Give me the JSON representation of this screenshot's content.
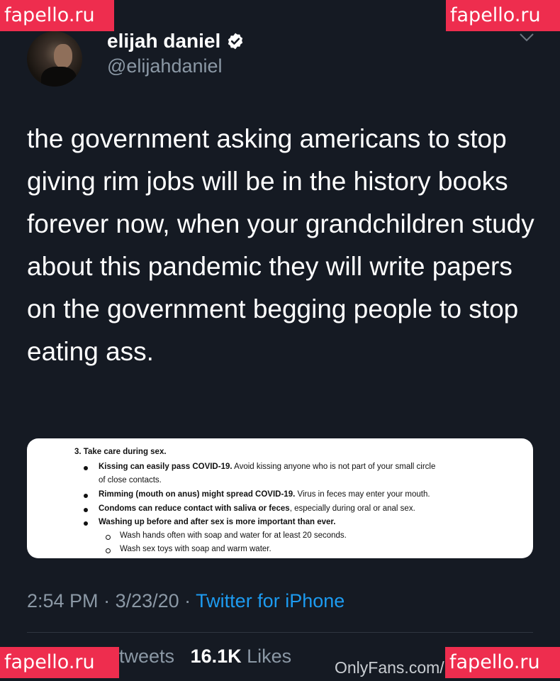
{
  "watermarks": {
    "top_left": "fapello.ru",
    "top_right": "fapello.ru",
    "bottom_left": "fapello.ru",
    "bottom_right": "fapello.ru",
    "onlyfans": "OnlyFans.com/"
  },
  "author": {
    "display_name": "elijah daniel",
    "handle": "@elijahdaniel",
    "verified_icon": "verified-badge-icon",
    "menu_icon": "chevron-down-icon"
  },
  "tweet": {
    "text": "the government asking americans to stop giving rim jobs will be in the history books forever now, when your grandchildren study about this pandemic they will write papers on the government begging people to stop eating ass."
  },
  "media": {
    "heading": "3. Take care during sex.",
    "items": [
      {
        "bold": "Kissing can easily pass COVID-19.",
        "text": " Avoid kissing anyone who is not part of your small circle",
        "continuation": "of close contacts."
      },
      {
        "bold": "Rimming (mouth on anus) might spread COVID-19.",
        "text": " Virus in feces may enter your mouth."
      },
      {
        "bold": "Condoms can reduce contact with saliva or feces",
        "text": ", especially during oral or anal sex."
      },
      {
        "bold": "Washing up before and after sex is more important than ever.",
        "text": ""
      }
    ],
    "subitems": [
      "Wash hands often with soap and water for at least 20 seconds.",
      "Wash sex toys with soap and warm water."
    ]
  },
  "meta": {
    "time": "2:54 PM",
    "separator1": " · ",
    "date": "3/23/20",
    "separator2": " · ",
    "source": "Twitter for iPhone"
  },
  "stats": {
    "retweets_label": "tweets",
    "likes_count": "16.1K",
    "likes_label": "Likes"
  },
  "colors": {
    "background": "#151a23",
    "link": "#1d9bf0",
    "watermark": "#ee2d4e",
    "secondary_text": "#8b98a5"
  }
}
